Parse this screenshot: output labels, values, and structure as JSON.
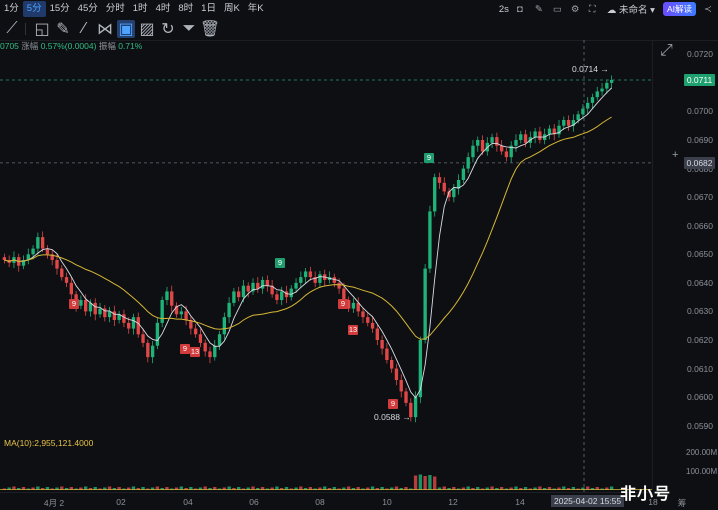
{
  "intervals": [
    "1分",
    "5分",
    "15分",
    "45分",
    "分时",
    "1时",
    "4时",
    "8时",
    "1日",
    "周K",
    "年K"
  ],
  "active_interval": "5分",
  "top_right": {
    "refresh": "2s",
    "layout_name": "未命名",
    "ai_button": "AI解读"
  },
  "info_bar": {
    "price": "0705",
    "change_label": "涨幅",
    "change": "0.57%(0.0004)",
    "amp_label": "振幅",
    "amp": "0.71%"
  },
  "y_ticks": [
    "0.0720",
    "0.0710",
    "0.0700",
    "0.0690",
    "0.0680",
    "0.0670",
    "0.0660",
    "0.0650",
    "0.0640",
    "0.0630",
    "0.0620",
    "0.0610",
    "0.0600",
    "0.0590"
  ],
  "current_price": "0.0711",
  "cross_price": "0.0682",
  "high_label": "0.0714",
  "low_label": "0.0588",
  "ma_label": "MA(10):2,955,121.4000",
  "vol_ticks": [
    "200.00M",
    "100.00M"
  ],
  "x_ticks": [
    "4月 2",
    "02",
    "04",
    "06",
    "08",
    "10",
    "12",
    "14",
    "18"
  ],
  "x_highlight": "2025-04-02 15:55",
  "x_right": "筹",
  "brand": "非小号",
  "td_labels": {
    "a": "9",
    "b": "9",
    "c": "13",
    "d": "9",
    "e": "13",
    "f": "9",
    "g": "9",
    "h": "9"
  },
  "chart_data": {
    "type": "candlestick",
    "ylim": [
      0.0585,
      0.0725
    ],
    "closes": [
      0.0648,
      0.0647,
      0.0649,
      0.0646,
      0.0648,
      0.065,
      0.0652,
      0.0656,
      0.0652,
      0.065,
      0.0648,
      0.0645,
      0.0642,
      0.064,
      0.0636,
      0.0632,
      0.0634,
      0.063,
      0.0633,
      0.0629,
      0.0631,
      0.0628,
      0.063,
      0.0627,
      0.0629,
      0.0626,
      0.0624,
      0.0628,
      0.0622,
      0.0619,
      0.0614,
      0.0618,
      0.0626,
      0.0634,
      0.0637,
      0.0632,
      0.0629,
      0.063,
      0.0627,
      0.0624,
      0.0622,
      0.0619,
      0.0616,
      0.0614,
      0.0618,
      0.0622,
      0.0628,
      0.0633,
      0.0637,
      0.0635,
      0.0639,
      0.0637,
      0.064,
      0.0638,
      0.0641,
      0.0639,
      0.0636,
      0.0634,
      0.0637,
      0.0635,
      0.0638,
      0.064,
      0.0642,
      0.0644,
      0.0642,
      0.064,
      0.0643,
      0.0641,
      0.0642,
      0.064,
      0.0638,
      0.0634,
      0.0631,
      0.0633,
      0.063,
      0.0628,
      0.0626,
      0.0624,
      0.062,
      0.0617,
      0.0613,
      0.061,
      0.0606,
      0.0602,
      0.0598,
      0.0593,
      0.06,
      0.062,
      0.0645,
      0.0665,
      0.0677,
      0.0675,
      0.0672,
      0.067,
      0.0673,
      0.0676,
      0.068,
      0.0684,
      0.0688,
      0.069,
      0.0686,
      0.0689,
      0.0691,
      0.0688,
      0.0686,
      0.0684,
      0.0688,
      0.069,
      0.0692,
      0.0689,
      0.0691,
      0.0693,
      0.069,
      0.0692,
      0.0694,
      0.0692,
      0.0695,
      0.0697,
      0.0695,
      0.0697,
      0.0699,
      0.0701,
      0.0703,
      0.0705,
      0.0707,
      0.0708,
      0.071,
      0.0711
    ]
  }
}
